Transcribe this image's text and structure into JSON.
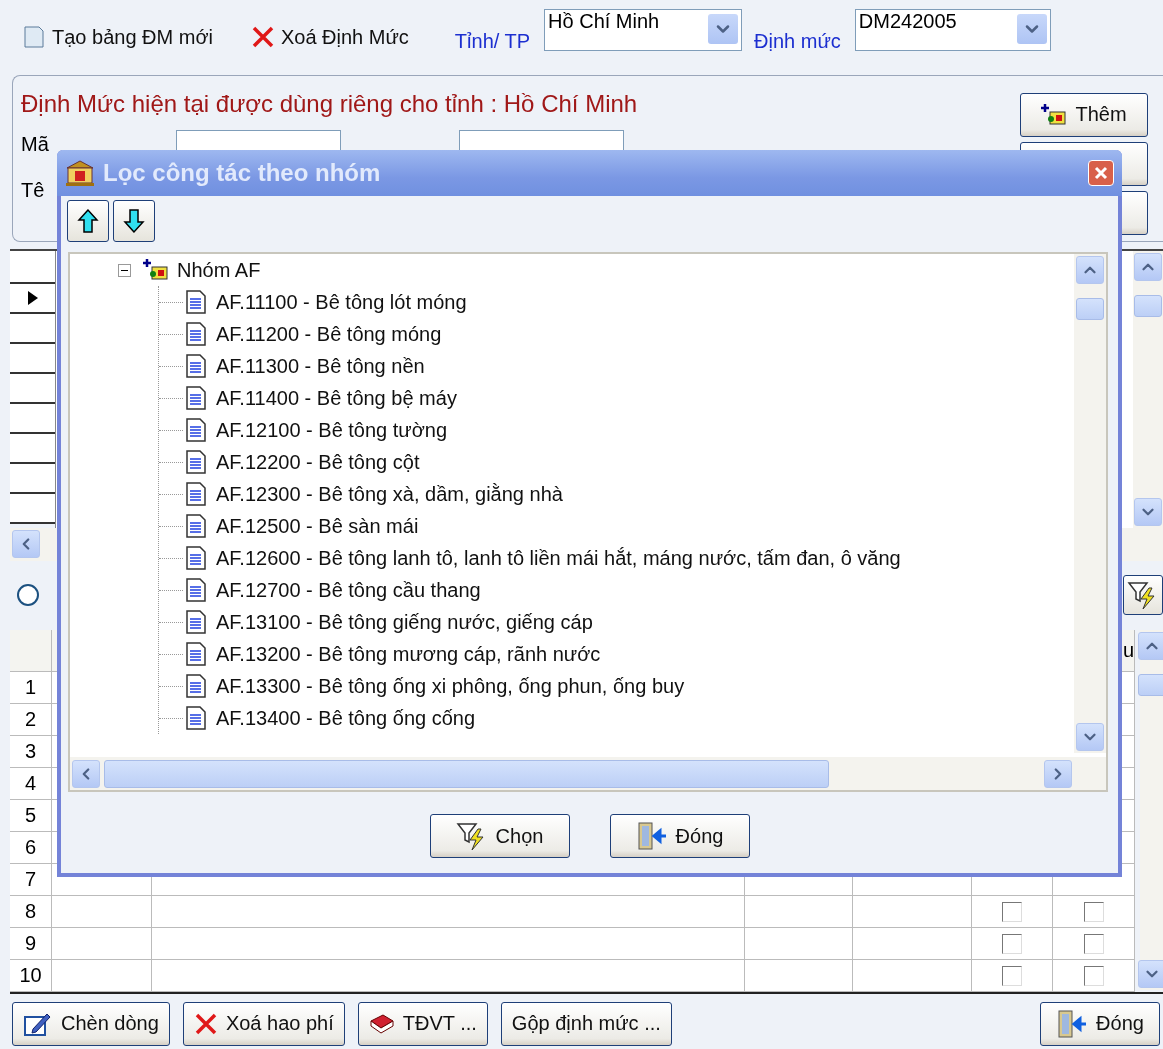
{
  "toolbar": {
    "buttons": [
      {
        "label": "Tạo bảng ĐM mới"
      },
      {
        "label": "Xoá Định Mức"
      }
    ],
    "fields": [
      {
        "label": "Tỉnh/ TP",
        "value": "Hồ Chí Minh"
      },
      {
        "label": "Định mức",
        "value": "DM242005"
      }
    ]
  },
  "norm_panel": {
    "title": "Định Mức hiện tại được dùng riêng cho tỉnh : Hồ Chí Minh",
    "field_labels": [
      "Mã",
      "Tê"
    ],
    "add_button": {
      "label": "Thêm"
    }
  },
  "upper_grid": {
    "rows": [
      {
        "selected": true
      },
      {
        "selected": false
      },
      {
        "selected": false
      },
      {
        "selected": false
      },
      {
        "selected": false
      },
      {
        "selected": false
      },
      {
        "selected": false
      },
      {
        "selected": false
      }
    ]
  },
  "filter_option": {
    "selected": false
  },
  "lower_grid": {
    "column_7_heading": "u",
    "rows": [
      {
        "number": "1"
      },
      {
        "number": "2"
      },
      {
        "number": "3"
      },
      {
        "number": "4"
      },
      {
        "number": "5"
      },
      {
        "number": "6"
      },
      {
        "number": "7"
      },
      {
        "number": "8",
        "checks": [
          false,
          false
        ]
      },
      {
        "number": "9",
        "checks": [
          false,
          false
        ]
      },
      {
        "number": "10",
        "checks": [
          false,
          false
        ]
      }
    ]
  },
  "bottom_buttons": [
    {
      "label": "Chèn dòng"
    },
    {
      "label": "Xoá hao phí"
    },
    {
      "label": "TĐVT ..."
    },
    {
      "label": "Gộp định mức ..."
    }
  ],
  "close_button": {
    "label": "Đóng"
  },
  "dialog": {
    "title": "Lọc công tác theo nhóm",
    "tree": [
      {
        "label": "Nhóm AF",
        "expanded": true,
        "children": [
          {
            "label": "AF.11100 - Bê tông lót móng"
          },
          {
            "label": "AF.11200 - Bê tông móng"
          },
          {
            "label": "AF.11300 - Bê tông nền"
          },
          {
            "label": "AF.11400 - Bê tông bệ máy"
          },
          {
            "label": "AF.12100 - Bê tông tường"
          },
          {
            "label": "AF.12200 - Bê tông cột"
          },
          {
            "label": "AF.12300 - Bê tông xà, dầm, giằng nhà"
          },
          {
            "label": "AF.12500 - Bê sàn mái"
          },
          {
            "label": "AF.12600 - Bê tông lanh tô, lanh tô liền mái hắt, máng nước, tấm đan, ô văng"
          },
          {
            "label": "AF.12700 - Bê tông cầu thang"
          },
          {
            "label": "AF.13100 - Bê tông giếng nước, giếng cáp"
          },
          {
            "label": "AF.13200 - Bê tông mương cáp, rãnh nước"
          },
          {
            "label": "AF.13300 - Bê tông ống xi phông, ống phun, ống buy"
          },
          {
            "label": "AF.13400 - Bê tông ống cống"
          }
        ]
      }
    ],
    "buttons": [
      {
        "label": "Chọn"
      },
      {
        "label": "Đóng"
      }
    ]
  }
}
